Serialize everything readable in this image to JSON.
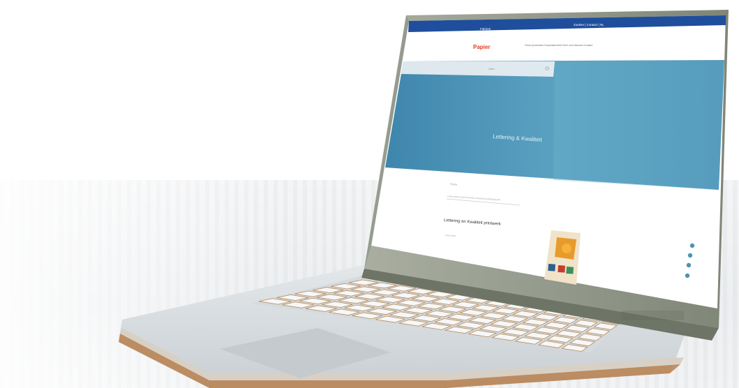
{
  "scene": {
    "description_hidden": "",
    "accent": "#1f4e9c",
    "hero_color": "#4c93b6",
    "brand_color": "#e23b1c"
  },
  "browser": {
    "topbar_left": "Fabriek",
    "topbar_right": "Zoeken  |  Contact  |  NL"
  },
  "site": {
    "logo": "Papier",
    "nav": "Onze producten   Duurzaamheid   Over ons   Nieuws   Contact",
    "search_placeholder": "Zoek...",
    "hero_title": "Lettering & Kwaliteit"
  },
  "content": {
    "breadcrumb": "Home",
    "intro": "Lorem ipsum dolor sit amet consectetur adipiscing elit",
    "heading": "Lettering en Kwaliteit printwerk",
    "subtext": "Lees meer"
  },
  "sidebar_icons": [
    "facebook-icon",
    "twitter-icon",
    "linkedin-icon",
    "mail-icon"
  ]
}
